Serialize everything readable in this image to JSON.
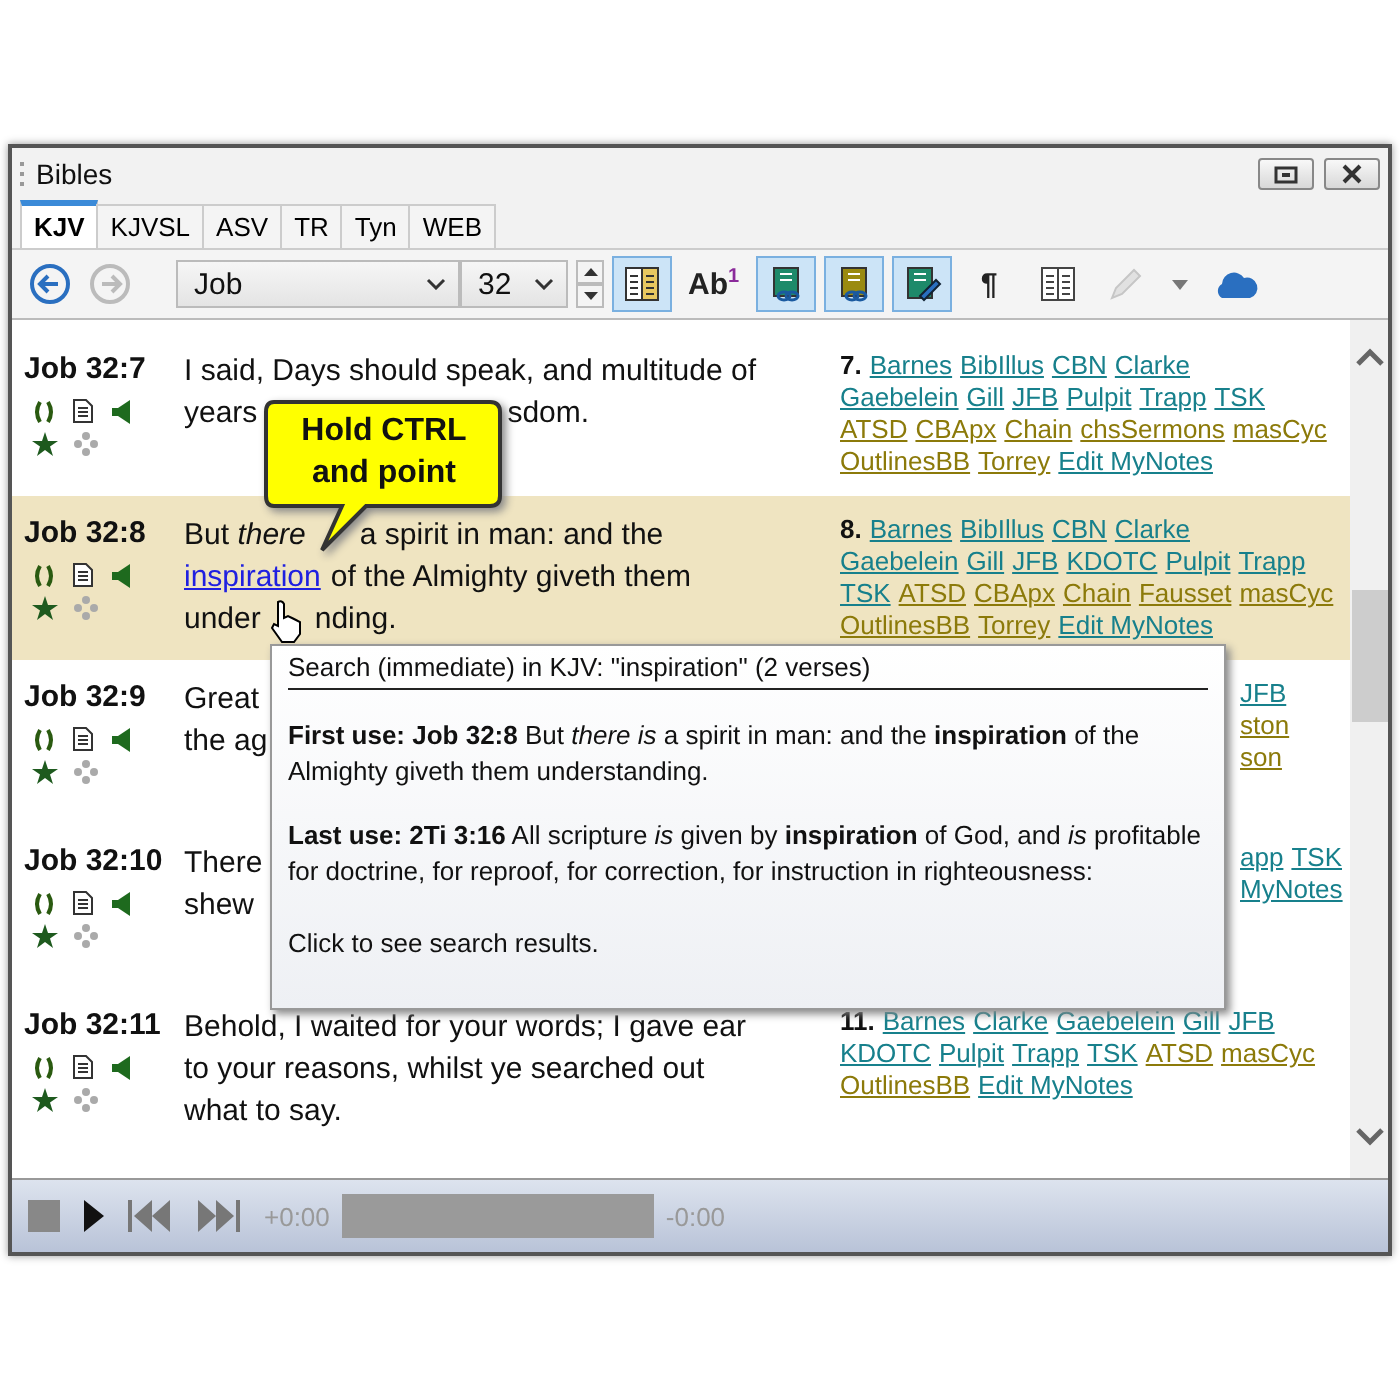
{
  "window": {
    "title": "Bibles"
  },
  "tabs": [
    {
      "label": "KJV",
      "selected": true
    },
    {
      "label": "KJVSL",
      "selected": false
    },
    {
      "label": "ASV",
      "selected": false
    },
    {
      "label": "TR",
      "selected": false
    },
    {
      "label": "Tyn",
      "selected": false
    },
    {
      "label": "WEB",
      "selected": false
    }
  ],
  "nav": [
    {
      "kind": "back",
      "disabled": false
    },
    {
      "kind": "forward",
      "disabled": true
    }
  ],
  "book_select": {
    "value": "Job"
  },
  "chapter_select": {
    "value": "32"
  },
  "toolbar": [
    {
      "kind": "columns",
      "selected": true,
      "disabled": false
    },
    {
      "kind": "text",
      "label": "Ab$^{1}$",
      "selected": false,
      "disabled": false
    },
    {
      "kind": "link-green",
      "selected": true,
      "disabled": false
    },
    {
      "kind": "link-olive",
      "selected": true,
      "disabled": false
    },
    {
      "kind": "edit-note",
      "selected": true,
      "disabled": false
    },
    {
      "kind": "text",
      "label": "¶",
      "selected": false,
      "disabled": false
    },
    {
      "kind": "table",
      "selected": false,
      "disabled": false
    },
    {
      "kind": "pencil",
      "selected": false,
      "disabled": true
    },
    {
      "kind": "caret",
      "selected": false,
      "disabled": false
    },
    {
      "kind": "cloud",
      "selected": false,
      "disabled": false
    }
  ],
  "verses": [
    {
      "ref": "Job 32:7",
      "selected": false,
      "lines": [
        [
          {
            "text": "I said, Days should speak, and multitude of",
            "kind": "text"
          }
        ],
        [
          {
            "text": "years",
            "kind": "text"
          },
          {
            "text": "sdom.",
            "kind": "after_callout"
          }
        ]
      ],
      "notes": {
        "number": "7.",
        "lines": [
          [
            {
              "text": "Barnes",
              "color": "#17808c"
            },
            {
              "text": "BibIllus",
              "color": "#17808c"
            },
            {
              "text": "CBN",
              "color": "#17808c"
            },
            {
              "text": "Clarke",
              "color": "#17808c"
            }
          ],
          [
            {
              "text": "Gaebelein",
              "color": "#17808c"
            },
            {
              "text": "Gill",
              "color": "#17808c"
            },
            {
              "text": "JFB",
              "color": "#17808c"
            },
            {
              "text": "Pulpit",
              "color": "#17808c"
            },
            {
              "text": "Trapp",
              "color": "#17808c"
            },
            {
              "text": "TSK",
              "color": "#17808c"
            }
          ],
          [
            {
              "text": "ATSD",
              "color": "#8c7a0a"
            },
            {
              "text": "CBApx",
              "color": "#8c7a0a"
            },
            {
              "text": "Chain",
              "color": "#8c7a0a"
            },
            {
              "text": "chsSermons",
              "color": "#8c7a0a"
            },
            {
              "text": "masCyc",
              "color": "#8c7a0a"
            }
          ],
          [
            {
              "text": "OutlinesBB",
              "color": "#8c7a0a"
            },
            {
              "text": "Torrey",
              "color": "#8c7a0a"
            },
            {
              "text": "Edit MyNotes",
              "color": "#17808c"
            }
          ]
        ]
      }
    },
    {
      "ref": "Job 32:8",
      "selected": true,
      "lines": [
        [
          {
            "text": "But *there*",
            "kind": "text"
          },
          {
            "text": "a spirit in man: and the",
            "kind": "after_tail"
          }
        ],
        [
          {
            "text": "inspiration",
            "kind": "link"
          },
          {
            "text": "of the Almighty giveth them",
            "kind": "text"
          }
        ],
        [
          {
            "text": "under",
            "kind": "text"
          },
          {
            "text": "nding.",
            "kind": "after_tail"
          }
        ]
      ],
      "notes": {
        "number": "8.",
        "lines": [
          [
            {
              "text": "Barnes",
              "color": "#17808c"
            },
            {
              "text": "BibIllus",
              "color": "#17808c"
            },
            {
              "text": "CBN",
              "color": "#17808c"
            },
            {
              "text": "Clarke",
              "color": "#17808c"
            }
          ],
          [
            {
              "text": "Gaebelein",
              "color": "#17808c"
            },
            {
              "text": "Gill",
              "color": "#17808c"
            },
            {
              "text": "JFB",
              "color": "#17808c"
            },
            {
              "text": "KDOTC",
              "color": "#17808c"
            },
            {
              "text": "Pulpit",
              "color": "#17808c"
            },
            {
              "text": "Trapp",
              "color": "#17808c"
            }
          ],
          [
            {
              "text": "TSK",
              "color": "#17808c"
            },
            {
              "text": "ATSD",
              "color": "#8c7a0a"
            },
            {
              "text": "CBApx",
              "color": "#8c7a0a"
            },
            {
              "text": "Chain",
              "color": "#8c7a0a"
            },
            {
              "text": "Fausset",
              "color": "#8c7a0a"
            },
            {
              "text": "masCyc",
              "color": "#8c7a0a"
            }
          ],
          [
            {
              "text": "OutlinesBB",
              "color": "#8c7a0a"
            },
            {
              "text": "Torrey",
              "color": "#8c7a0a"
            },
            {
              "text": "Edit MyNotes",
              "color": "#17808c"
            }
          ]
        ]
      }
    },
    {
      "ref": "Job 32:9",
      "selected": false,
      "lines": [
        [
          {
            "text": "Great",
            "kind": "text"
          }
        ],
        [
          {
            "text": "the ag",
            "kind": "text"
          }
        ]
      ],
      "notes": {
        "lines": [
          [
            {
              "text": "JFB",
              "color": "#17808c"
            }
          ],
          [
            {
              "text": "ston",
              "color": "#8c7a0a"
            }
          ],
          [
            {
              "text": "son",
              "color": "#8c7a0a"
            }
          ]
        ]
      }
    },
    {
      "ref": "Job 32:10",
      "selected": false,
      "lines": [
        [
          {
            "text": "There",
            "kind": "text"
          }
        ],
        [
          {
            "text": "shew",
            "kind": "text"
          }
        ]
      ],
      "notes": {
        "lines": [
          [
            {
              "text": "app",
              "color": "#17808c"
            },
            {
              "text": "TSK",
              "color": "#17808c"
            }
          ],
          [
            {
              "text": "MyNotes",
              "color": "#17808c"
            }
          ]
        ]
      }
    },
    {
      "ref": "Job 32:11",
      "selected": false,
      "lines": [
        [
          {
            "text": "Behold, I waited for your words; I gave ear",
            "kind": "text"
          }
        ],
        [
          {
            "text": "to your reasons, whilst ye searched out",
            "kind": "text"
          }
        ],
        [
          {
            "text": "what to say.",
            "kind": "text"
          }
        ]
      ],
      "notes": {
        "number": "11.",
        "lines": [
          [
            {
              "text": "Barnes",
              "color": "#17808c"
            },
            {
              "text": "Clarke",
              "color": "#17808c"
            },
            {
              "text": "Gaebelein",
              "color": "#17808c"
            },
            {
              "text": "Gill",
              "color": "#17808c"
            },
            {
              "text": "JFB",
              "color": "#17808c"
            }
          ],
          [
            {
              "text": "KDOTC",
              "color": "#17808c"
            },
            {
              "text": "Pulpit",
              "color": "#17808c"
            },
            {
              "text": "Trapp",
              "color": "#17808c"
            },
            {
              "text": "TSK",
              "color": "#17808c"
            },
            {
              "text": "ATSD",
              "color": "#8c7a0a"
            },
            {
              "text": "masCyc",
              "color": "#8c7a0a"
            }
          ],
          [
            {
              "text": "OutlinesBB",
              "color": "#8c7a0a"
            },
            {
              "text": "Edit MyNotes",
              "color": "#17808c"
            }
          ]
        ]
      }
    }
  ],
  "callout": {
    "text": "Hold CTRL and point"
  },
  "popup": {
    "title": "Search (immediate) in KJV: \"inspiration\" (2 verses)",
    "paragraphs": [
      "**First use: Job 32:8** But *there is* a spirit in man: and the **inspiration** of the Almighty giveth them understanding.",
      "**Last use: 2Ti 3:16** All scripture *is* given by **inspiration** of God, and *is* profitable for doctrine, for reproof, for correction, for instruction in righteousness:"
    ],
    "footer": "Click to see search results."
  },
  "player": {
    "elapsed": "+0:00",
    "remaining": "-0:00"
  }
}
